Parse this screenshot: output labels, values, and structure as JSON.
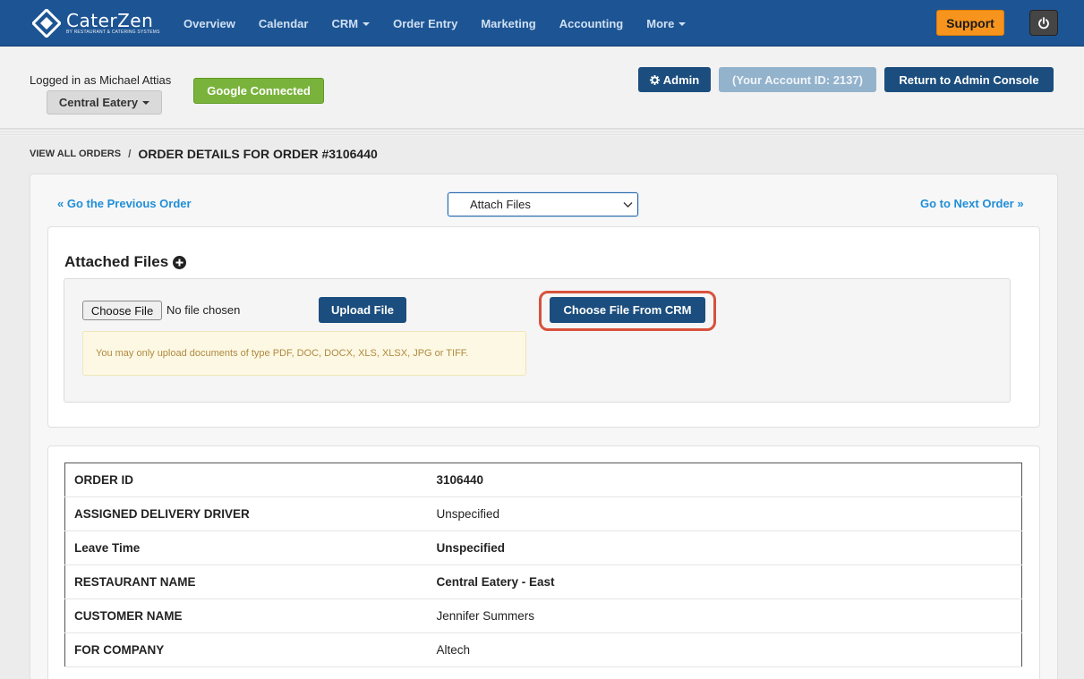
{
  "brand": {
    "name": "CaterZen",
    "tagline": "By Restaurant & Catering Systems"
  },
  "nav": {
    "items": [
      {
        "label": "Overview",
        "dropdown": false
      },
      {
        "label": "Calendar",
        "dropdown": false
      },
      {
        "label": "CRM",
        "dropdown": true
      },
      {
        "label": "Order Entry",
        "dropdown": false
      },
      {
        "label": "Marketing",
        "dropdown": false
      },
      {
        "label": "Accounting",
        "dropdown": false
      },
      {
        "label": "More",
        "dropdown": true
      }
    ],
    "support_label": "Support",
    "power_icon": "power-icon"
  },
  "account": {
    "logged_in_text": "Logged in as Michael Attias",
    "location": "Central Eatery",
    "google_status": "Google Connected",
    "admin_label": "Admin",
    "account_id_label": "(Your Account ID: 2137)",
    "return_label": "Return to Admin Console"
  },
  "breadcrumb": {
    "parent": "View All Orders",
    "separator": "/",
    "current": "ORDER DETAILS FOR ORDER #3106440"
  },
  "order_nav": {
    "prev_label": "« Go the Previous Order",
    "next_label": "Go to Next Order »",
    "action_select_value": "Attach Files"
  },
  "attached_files": {
    "title": "Attached Files",
    "choose_file_label": "Choose File",
    "no_file_text": "No file chosen",
    "upload_label": "Upload File",
    "choose_crm_label": "Choose File From CRM",
    "warning": "You may only upload documents of type PDF, DOC, DOCX, XLS, XLSX, JPG or TIFF."
  },
  "details": {
    "rows": [
      {
        "key": "ORDER ID",
        "value": "3106440",
        "bold": true
      },
      {
        "key": "ASSIGNED DELIVERY DRIVER",
        "value": "Unspecified",
        "bold": false
      },
      {
        "key": "Leave Time",
        "value": "Unspecified",
        "bold": true
      },
      {
        "key": "RESTAURANT NAME",
        "value": "Central Eatery - East",
        "bold": true
      },
      {
        "key": "CUSTOMER NAME",
        "value": "Jennifer Summers",
        "bold": false
      },
      {
        "key": "FOR COMPANY",
        "value": "Altech",
        "bold": false
      }
    ]
  },
  "colors": {
    "navbar": "#1d5493",
    "primary_button": "#1b4e7e",
    "support": "#f7941d",
    "google": "#7ab33c",
    "link": "#1f8ed8",
    "highlight": "#d8513c"
  }
}
